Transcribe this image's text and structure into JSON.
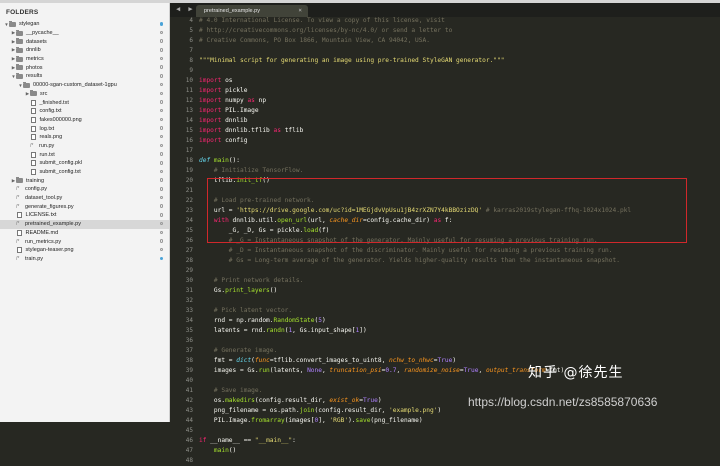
{
  "sidebar": {
    "title": "FOLDERS",
    "items": [
      {
        "label": "stylegan",
        "indent": 0,
        "type": "folder",
        "expanded": true,
        "dot": "filled"
      },
      {
        "label": "__pycache__",
        "indent": 1,
        "type": "folder",
        "expanded": false,
        "dot": "empty"
      },
      {
        "label": "datasets",
        "indent": 1,
        "type": "folder",
        "expanded": false,
        "dot": "empty"
      },
      {
        "label": "dnnlib",
        "indent": 1,
        "type": "folder",
        "expanded": false,
        "dot": "empty"
      },
      {
        "label": "metrics",
        "indent": 1,
        "type": "folder",
        "expanded": false,
        "dot": "empty"
      },
      {
        "label": "photos",
        "indent": 1,
        "type": "folder",
        "expanded": false,
        "dot": "empty"
      },
      {
        "label": "results",
        "indent": 1,
        "type": "folder",
        "expanded": true,
        "dot": "empty"
      },
      {
        "label": "00000-sgan-custom_dataset-1gpu",
        "indent": 2,
        "type": "folder",
        "expanded": true,
        "dot": "empty"
      },
      {
        "label": "src",
        "indent": 3,
        "type": "folder",
        "expanded": false,
        "dot": "empty"
      },
      {
        "label": "_finished.txt",
        "indent": 3,
        "type": "file",
        "dot": "empty"
      },
      {
        "label": "config.txt",
        "indent": 3,
        "type": "file",
        "dot": "empty"
      },
      {
        "label": "fakes000000.png",
        "indent": 3,
        "type": "file",
        "dot": "empty"
      },
      {
        "label": "log.txt",
        "indent": 3,
        "type": "file",
        "dot": "empty"
      },
      {
        "label": "reals.png",
        "indent": 3,
        "type": "file",
        "dot": "empty"
      },
      {
        "label": "run.py",
        "indent": 3,
        "type": "code",
        "dot": "empty"
      },
      {
        "label": "run.txt",
        "indent": 3,
        "type": "file",
        "dot": "empty"
      },
      {
        "label": "submit_config.pkl",
        "indent": 3,
        "type": "file",
        "dot": "empty"
      },
      {
        "label": "submit_config.txt",
        "indent": 3,
        "type": "file",
        "dot": "empty"
      },
      {
        "label": "training",
        "indent": 1,
        "type": "folder",
        "expanded": false,
        "dot": "empty"
      },
      {
        "label": "config.py",
        "indent": 1,
        "type": "code",
        "dot": "empty"
      },
      {
        "label": "dataset_tool.py",
        "indent": 1,
        "type": "code",
        "dot": "empty"
      },
      {
        "label": "generate_figures.py",
        "indent": 1,
        "type": "code",
        "dot": "empty"
      },
      {
        "label": "LICENSE.txt",
        "indent": 1,
        "type": "file",
        "dot": "empty"
      },
      {
        "label": "pretrained_example.py",
        "indent": 1,
        "type": "code",
        "dot": "empty",
        "selected": true
      },
      {
        "label": "README.md",
        "indent": 1,
        "type": "file",
        "dot": "empty"
      },
      {
        "label": "run_metrics.py",
        "indent": 1,
        "type": "code",
        "dot": "empty"
      },
      {
        "label": "stylegan-teaser.png",
        "indent": 1,
        "type": "file",
        "dot": "empty"
      },
      {
        "label": "train.py",
        "indent": 1,
        "type": "code",
        "dot": "filled"
      }
    ]
  },
  "tabbar": {
    "nav_arrows": "◀ ▶",
    "active_tab": "pretrained_example.py",
    "close_glyph": "×"
  },
  "editor": {
    "lines": [
      {
        "n": "4",
        "t": [
          [
            "# 4.0 International License. To view a copy of this license, visit",
            "cm"
          ]
        ]
      },
      {
        "n": "5",
        "t": [
          [
            "# http://creativecommons.org/licenses/by-nc/4.0/ or send a letter to",
            "cm"
          ]
        ]
      },
      {
        "n": "6",
        "t": [
          [
            "# Creative Commons, PO Box 1866, Mountain View, CA 94042, USA.",
            "cm"
          ]
        ]
      },
      {
        "n": "7",
        "t": []
      },
      {
        "n": "8",
        "t": [
          [
            "\"\"\"Minimal script for generating an image using pre-trained StyleGAN generator.\"\"\"",
            "str"
          ]
        ]
      },
      {
        "n": "9",
        "t": []
      },
      {
        "n": "10",
        "t": [
          [
            "import",
            "kw"
          ],
          [
            " os",
            ""
          ]
        ]
      },
      {
        "n": "11",
        "t": [
          [
            "import",
            "kw"
          ],
          [
            " pickle",
            ""
          ]
        ]
      },
      {
        "n": "12",
        "t": [
          [
            "import",
            "kw"
          ],
          [
            " numpy ",
            ""
          ],
          [
            "as",
            "kw"
          ],
          [
            " np",
            ""
          ]
        ]
      },
      {
        "n": "13",
        "t": [
          [
            "import",
            "kw"
          ],
          [
            " PIL.Image",
            ""
          ]
        ]
      },
      {
        "n": "14",
        "t": [
          [
            "import",
            "kw"
          ],
          [
            " dnnlib",
            ""
          ]
        ]
      },
      {
        "n": "15",
        "t": [
          [
            "import",
            "kw"
          ],
          [
            " dnnlib.tflib ",
            ""
          ],
          [
            "as",
            "kw"
          ],
          [
            " tflib",
            ""
          ]
        ]
      },
      {
        "n": "16",
        "t": [
          [
            "import",
            "kw"
          ],
          [
            " config",
            ""
          ]
        ]
      },
      {
        "n": "17",
        "t": []
      },
      {
        "n": "18",
        "t": [
          [
            "def",
            "bi"
          ],
          [
            " ",
            ""
          ],
          [
            "main",
            "fn"
          ],
          [
            "():",
            ""
          ]
        ]
      },
      {
        "n": "19",
        "t": [
          [
            "    # Initialize TensorFlow.",
            "cm"
          ]
        ]
      },
      {
        "n": "20",
        "t": [
          [
            "    tflib.",
            ""
          ],
          [
            "init_tf",
            "fn"
          ],
          [
            "()",
            ""
          ]
        ]
      },
      {
        "n": "21",
        "t": []
      },
      {
        "n": "22",
        "t": [
          [
            "    # Load pre-trained network.",
            "cm"
          ]
        ]
      },
      {
        "n": "23",
        "t": [
          [
            "    url = ",
            ""
          ],
          [
            "'https://drive.google.com/uc?id=1MEGjdvVpUsu1jB4zrXZN7Y4kBBOzizDQ'",
            "str"
          ],
          [
            " # karras2019stylegan-ffhq-1024x1024.pkl",
            "cm"
          ]
        ]
      },
      {
        "n": "24",
        "t": [
          [
            "    ",
            ""
          ],
          [
            "with",
            "kw"
          ],
          [
            " dnnlib.util.",
            ""
          ],
          [
            "open_url",
            "fn"
          ],
          [
            "(url, ",
            ""
          ],
          [
            "cache_dir",
            "arg"
          ],
          [
            "=config.cache_dir) ",
            ""
          ],
          [
            "as",
            "kw"
          ],
          [
            " f:",
            ""
          ]
        ]
      },
      {
        "n": "25",
        "t": [
          [
            "        _G, _D, Gs = pickle.",
            ""
          ],
          [
            "load",
            "fn"
          ],
          [
            "(f)",
            ""
          ]
        ]
      },
      {
        "n": "26",
        "t": [
          [
            "        # _G = Instantaneous snapshot of the generator. Mainly useful for resuming a previous training run.",
            "cm"
          ]
        ]
      },
      {
        "n": "27",
        "t": [
          [
            "        # _D = Instantaneous snapshot of the discriminator. Mainly useful for resuming a previous training run.",
            "cm"
          ]
        ]
      },
      {
        "n": "28",
        "t": [
          [
            "        # Gs = Long-term average of the generator. Yields higher-quality results than the instantaneous snapshot.",
            "cm"
          ]
        ]
      },
      {
        "n": "29",
        "t": []
      },
      {
        "n": "30",
        "t": [
          [
            "    # Print network details.",
            "cm"
          ]
        ]
      },
      {
        "n": "31",
        "t": [
          [
            "    Gs.",
            ""
          ],
          [
            "print_layers",
            "fn"
          ],
          [
            "()",
            ""
          ]
        ]
      },
      {
        "n": "32",
        "t": []
      },
      {
        "n": "33",
        "t": [
          [
            "    # Pick latent vector.",
            "cm"
          ]
        ]
      },
      {
        "n": "34",
        "t": [
          [
            "    rnd = np.random.",
            ""
          ],
          [
            "RandomState",
            "fn"
          ],
          [
            "(",
            ""
          ],
          [
            "5",
            "num"
          ],
          [
            ")",
            ""
          ]
        ]
      },
      {
        "n": "35",
        "t": [
          [
            "    latents = rnd.",
            ""
          ],
          [
            "randn",
            "fn"
          ],
          [
            "(",
            ""
          ],
          [
            "1",
            "num"
          ],
          [
            ", Gs.input_shape[",
            ""
          ],
          [
            "1",
            "num"
          ],
          [
            "])",
            ""
          ]
        ]
      },
      {
        "n": "36",
        "t": []
      },
      {
        "n": "37",
        "t": [
          [
            "    # Generate image.",
            "cm"
          ]
        ]
      },
      {
        "n": "38",
        "t": [
          [
            "    fmt = ",
            ""
          ],
          [
            "dict",
            "bi"
          ],
          [
            "(",
            ""
          ],
          [
            "func",
            "arg"
          ],
          [
            "=tflib.convert_images_to_uint8, ",
            ""
          ],
          [
            "nchw_to_nhwc",
            "arg"
          ],
          [
            "=",
            ""
          ],
          [
            "True",
            "num"
          ],
          [
            ")",
            ""
          ]
        ]
      },
      {
        "n": "39",
        "t": [
          [
            "    images = Gs.",
            ""
          ],
          [
            "run",
            "fn"
          ],
          [
            "(latents, ",
            ""
          ],
          [
            "None",
            "num"
          ],
          [
            ", ",
            ""
          ],
          [
            "truncation_psi",
            "arg"
          ],
          [
            "=",
            ""
          ],
          [
            "0.7",
            "num"
          ],
          [
            ", ",
            ""
          ],
          [
            "randomize_noise",
            "arg"
          ],
          [
            "=",
            ""
          ],
          [
            "True",
            "num"
          ],
          [
            ", ",
            ""
          ],
          [
            "output_transform",
            "arg"
          ],
          [
            "=fmt)",
            ""
          ]
        ]
      },
      {
        "n": "40",
        "t": []
      },
      {
        "n": "41",
        "t": [
          [
            "    # Save image.",
            "cm"
          ]
        ]
      },
      {
        "n": "42",
        "t": [
          [
            "    os.",
            ""
          ],
          [
            "makedirs",
            "fn"
          ],
          [
            "(config.result_dir, ",
            ""
          ],
          [
            "exist_ok",
            "arg"
          ],
          [
            "=",
            ""
          ],
          [
            "True",
            "num"
          ],
          [
            ")",
            ""
          ]
        ]
      },
      {
        "n": "43",
        "t": [
          [
            "    png_filename = os.path.",
            ""
          ],
          [
            "join",
            "fn"
          ],
          [
            "(config.result_dir, ",
            ""
          ],
          [
            "'example.png'",
            "str"
          ],
          [
            ")",
            ""
          ]
        ]
      },
      {
        "n": "44",
        "t": [
          [
            "    PIL.Image.",
            ""
          ],
          [
            "fromarray",
            "fn"
          ],
          [
            "(images[",
            ""
          ],
          [
            "0",
            "num"
          ],
          [
            "], ",
            ""
          ],
          [
            "'RGB'",
            "str"
          ],
          [
            ").",
            ""
          ],
          [
            "save",
            "fn"
          ],
          [
            "(png_filename)",
            ""
          ]
        ]
      },
      {
        "n": "45",
        "t": []
      },
      {
        "n": "46",
        "t": [
          [
            "if",
            "kw"
          ],
          [
            " __name__ == ",
            ""
          ],
          [
            "\"__main__\"",
            "str"
          ],
          [
            ":",
            ""
          ]
        ]
      },
      {
        "n": "47",
        "t": [
          [
            "    ",
            ""
          ],
          [
            "main",
            "fn"
          ],
          [
            "()",
            ""
          ]
        ]
      },
      {
        "n": "48",
        "t": []
      }
    ]
  },
  "watermark": {
    "zhihu": "知乎 @徐先生",
    "url": "https://blog.csdn.net/zs8585870636"
  },
  "colors": {
    "editor_bg": "#272822",
    "comment": "#75715e",
    "keyword": "#f92672",
    "function": "#a6e22e",
    "string": "#e6db74",
    "number": "#ae81ff",
    "argument": "#fd971f",
    "highlight_box": "#d0282b"
  }
}
